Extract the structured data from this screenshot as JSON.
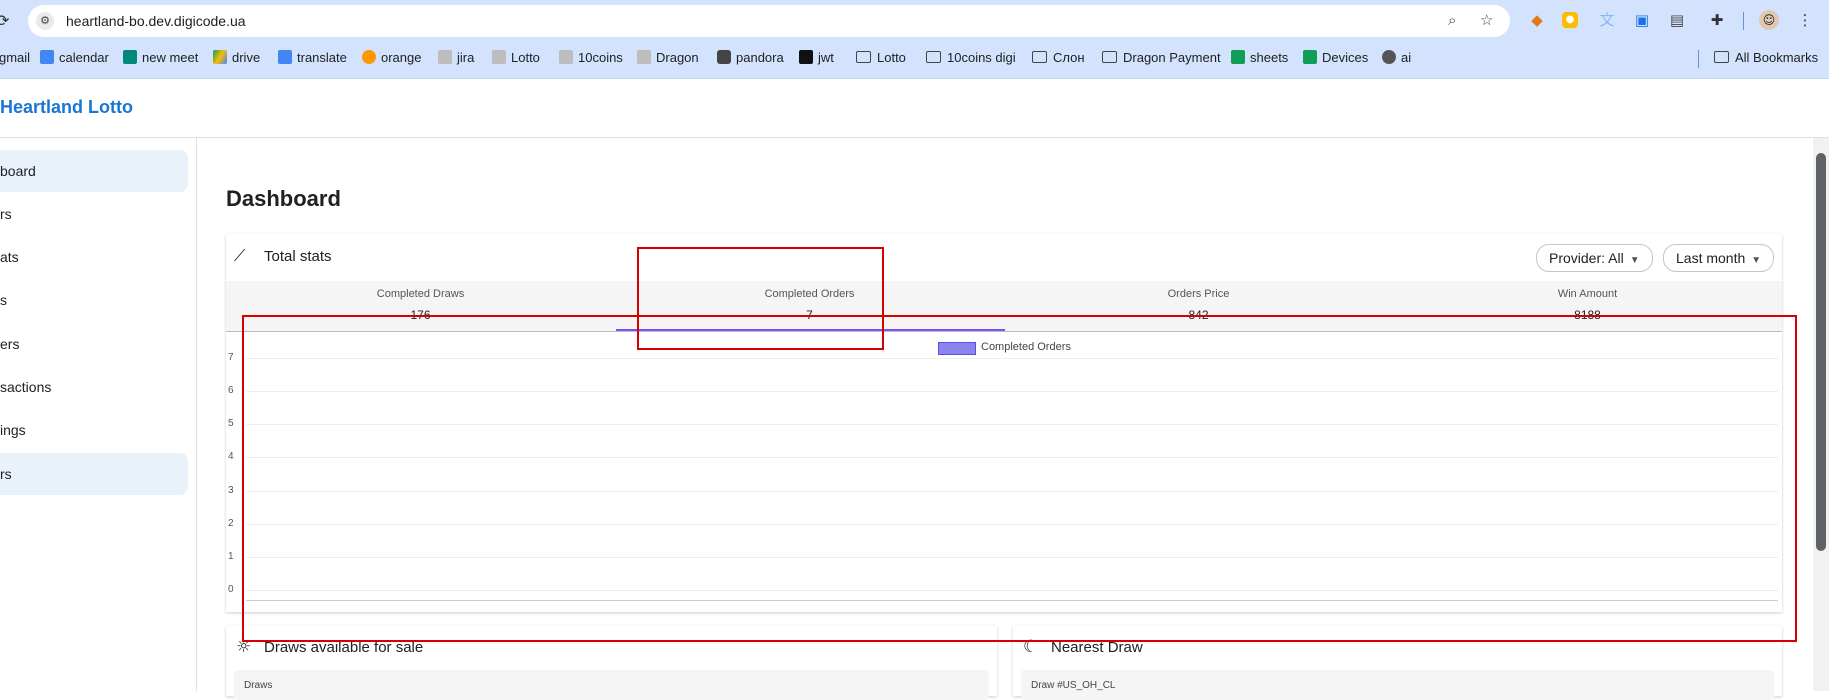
{
  "browser": {
    "url": "heartland-bo.dev.digicode.ua",
    "icons": [
      "reload-icon",
      "site-settings-icon",
      "zoom-icon",
      "star-icon",
      "metamask-icon",
      "keep-icon",
      "extension-icon",
      "extension-icon",
      "extension-icon",
      "puzzle-icon",
      "profile-avatar",
      "menu-icon"
    ],
    "bookmarks": [
      {
        "label": "gmail",
        "icon": "gmail-icon"
      },
      {
        "label": "calendar",
        "icon": "calendar-icon"
      },
      {
        "label": "new meet",
        "icon": "meet-icon"
      },
      {
        "label": "drive",
        "icon": "drive-icon"
      },
      {
        "label": "translate",
        "icon": "translate-icon"
      },
      {
        "label": "orange",
        "icon": "orange-icon"
      },
      {
        "label": "jira",
        "icon": "site-icon"
      },
      {
        "label": "Lotto",
        "icon": "site-icon"
      },
      {
        "label": "10coins",
        "icon": "site-icon"
      },
      {
        "label": "Dragon",
        "icon": "site-icon"
      },
      {
        "label": "pandora",
        "icon": "lock-icon"
      },
      {
        "label": "jwt",
        "icon": "jwt-icon"
      },
      {
        "label": "Lotto",
        "icon": "folder-icon"
      },
      {
        "label": "10coins digi",
        "icon": "folder-icon"
      },
      {
        "label": "Слон",
        "icon": "folder-icon"
      },
      {
        "label": "Dragon Payment",
        "icon": "folder-icon"
      },
      {
        "label": "sheets",
        "icon": "sheets-icon"
      },
      {
        "label": "Devices",
        "icon": "sheets-icon"
      },
      {
        "label": "ai",
        "icon": "ai-icon"
      }
    ],
    "all_bookmarks": "All Bookmarks"
  },
  "app": {
    "brand": "Heartland Lotto",
    "nav": [
      {
        "label": "board",
        "active": true
      },
      {
        "label": "rs",
        "active": false
      },
      {
        "label": "ats",
        "active": false
      },
      {
        "label": "s",
        "active": false
      },
      {
        "label": "ers",
        "active": false
      },
      {
        "label": "sactions",
        "active": false
      },
      {
        "label": "ings",
        "active": false
      },
      {
        "label": "rs",
        "active": true
      }
    ]
  },
  "dashboard": {
    "title": "Dashboard",
    "total_stats": {
      "title": "Total stats",
      "provider_filter": "Provider: All",
      "period_filter": "Last month",
      "stats": [
        {
          "label": "Completed Draws",
          "value": "176"
        },
        {
          "label": "Completed Orders",
          "value": "7"
        },
        {
          "label": "Orders Price",
          "value": "842"
        },
        {
          "label": "Win Amount",
          "value": "8188"
        }
      ]
    },
    "chart_legend": "Completed Orders",
    "draws_available": {
      "title": "Draws available for sale",
      "inner_label": "Draws"
    },
    "nearest_draw": {
      "title": "Nearest Draw",
      "inner_label": "Draw #US_OH_CL"
    }
  },
  "chart_data": {
    "type": "bar",
    "series": [
      {
        "name": "Completed Orders",
        "values": []
      }
    ],
    "yticks": [
      "0",
      "1",
      "2",
      "3",
      "4",
      "5",
      "6",
      "7"
    ],
    "ylim": [
      0,
      7
    ],
    "legend": "top-center",
    "colors": {
      "series": "#8b83ee",
      "border": "#5a4fe0"
    }
  },
  "colors": {
    "brand": "#1976d2",
    "highlight_box": "#d50000",
    "tab_indicator": "#7c4dff"
  }
}
